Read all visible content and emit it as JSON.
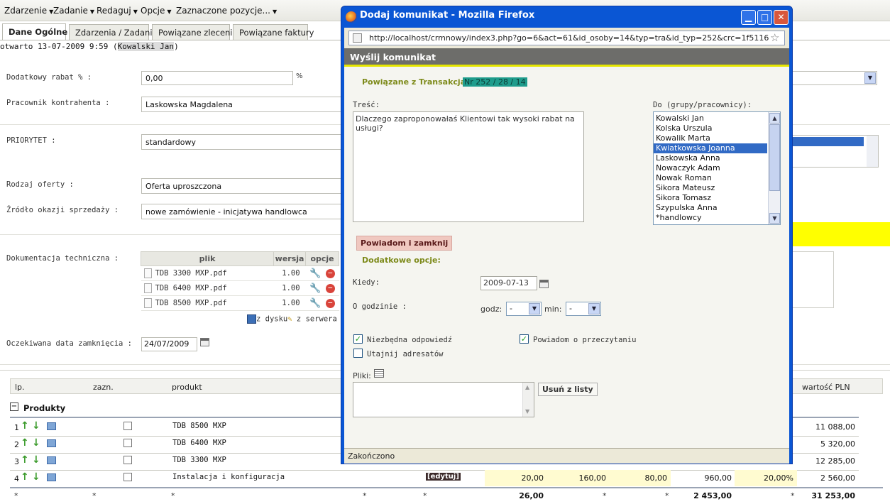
{
  "menu": {
    "items": [
      "Zdarzenie",
      "Zadanie",
      "Redaguj",
      "Opcje",
      "Zaznaczone pozycje..."
    ]
  },
  "tabs": [
    "Dane Ogólne",
    "Zdarzenia / Zadania",
    "Powiązane zlecenia",
    "Powiązane faktury"
  ],
  "header": {
    "opened_prefix": "otwarto 13-07-2009 9:59 (",
    "opened_user": "Kowalski Jan",
    "opened_suffix": ")"
  },
  "form": {
    "rabat_label": "Dodatkowy rabat % :",
    "rabat_value": "0,00",
    "rabat_unit": "%",
    "pracownik_label": "Pracownik kontrahenta :",
    "pracownik_value": "Laskowska Magdalena",
    "priorytet_label": "PRIORYTET :",
    "priorytet_value": "standardowy",
    "rodzaj_label": "Rodzaj oferty :",
    "rodzaj_value": "Oferta uproszczona",
    "zrodlo_label": "Źródło okazji sprzedaży :",
    "zrodlo_value": "nowe zamówienie - inicjatywa handlowca",
    "dok_label": "Dokumentacja techniczna :",
    "data_label": "Oczekiwana data zamknięcia :",
    "data_value": "24/07/2009"
  },
  "files": {
    "headers": [
      "plik",
      "wersja",
      "opcje"
    ],
    "rows": [
      {
        "name": "TDB 3300 MXP.pdf",
        "version": "1.00"
      },
      {
        "name": "TDB 6400 MXP.pdf",
        "version": "1.00"
      },
      {
        "name": "TDB 8500 MXP.pdf",
        "version": "1.00"
      }
    ],
    "from_disk": "z dysku",
    "from_server": "z serwera"
  },
  "products": {
    "columns": {
      "lp": "lp.",
      "zazn": "zazn.",
      "produkt": "produkt",
      "wartosc": "wartość PLN"
    },
    "group": "Produkty",
    "rows": [
      {
        "lp": "1",
        "name": "TDB 8500 MXP",
        "value": "11 088,00"
      },
      {
        "lp": "2",
        "name": "TDB 6400 MXP",
        "value": "5 320,00"
      },
      {
        "lp": "3",
        "name": "TDB 3300 MXP",
        "value": "12 285,00"
      },
      {
        "lp": "4",
        "name": "Instalacja i konfiguracja",
        "edit": "[edytuj]",
        "c1": "20,00",
        "c2": "160,00",
        "c3": "80,00",
        "c4": "960,00",
        "c5": "20,00%",
        "value": "2 560,00"
      }
    ],
    "totals": {
      "star": "*",
      "t1": "26,00",
      "t4": "2 453,00",
      "value": "31 253,00"
    }
  },
  "popup": {
    "window_title": "Dodaj komunikat - Mozilla Firefox",
    "url": "http://localhost/crmnowy/index3.php?go=6&act=61&id_osoby=14&typ=tra&id_typ=252&crc=1f5116",
    "heading": "Wyślij komunikat",
    "related_label": "Powiązane z Transakcja:",
    "related_value": "Nr 252 / 28 / 14",
    "tresc_label": "Treść:",
    "tresc_value": "Dlaczego zaproponowałaś Klientowi tak wysoki rabat na usługi?",
    "do_label": "Do (grupy/pracownicy):",
    "recipients": [
      "Kowalski Jan",
      "Kolska Urszula",
      "Kowalik Marta",
      "Kwiatkowska Joanna",
      "Laskowska Anna",
      "Nowaczyk Adam",
      "Nowak Roman",
      "Sikora Mateusz",
      "Sikora Tomasz",
      "Szypulska Anna",
      "*handlowcy"
    ],
    "selected_recipient": "Kwiatkowska Joanna",
    "notify_button": "Powiadom i zamknij",
    "extra_options": "Dodatkowe opcje:",
    "kiedy_label": "Kiedy:",
    "kiedy_value": "2009-07-13",
    "godzina_label": "O godzinie :",
    "godz_label": "godz:",
    "godz_value": "-",
    "min_label": "min:",
    "min_value": "-",
    "niezbedna": "Niezbędna odpowiedź",
    "niezbedna_checked": true,
    "powiadom_przecz": "Powiadom o przeczytaniu",
    "powiadom_checked": true,
    "utajnij": "Utajnij adresatów",
    "utajnij_checked": false,
    "pliki_label": "Pliki:",
    "remove_button": "Usuń z listy",
    "status": "Zakończono"
  },
  "colors": {
    "xp_blue": "#0a56d4",
    "olive": "#7d8a1a",
    "selection": "#316ac5",
    "highlight_yellow": "#ffff00"
  }
}
